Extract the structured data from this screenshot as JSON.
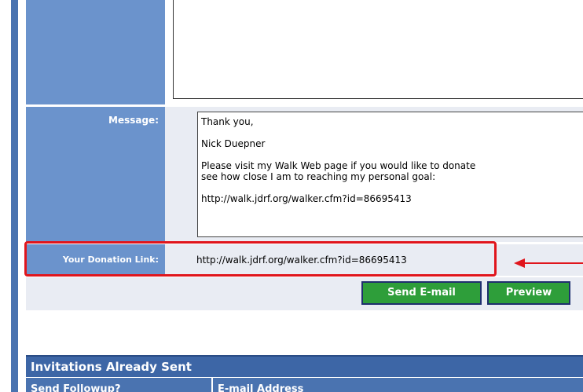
{
  "form": {
    "message_label": "Message:",
    "message_lines": [
      "Thank you,",
      "",
      "Nick Duepner",
      "",
      "Please visit my Walk Web page if you would like to donate",
      "see how close I am to reaching my personal goal:",
      "",
      "http://walk.jdrf.org/walker.cfm?id=86695413"
    ],
    "donation_label": "Your Donation Link:",
    "donation_link": "http://walk.jdrf.org/walker.cfm?id=86695413"
  },
  "buttons": {
    "send_label": "Send E-mail",
    "preview_label": "Preview"
  },
  "invitations": {
    "title": "Invitations Already Sent",
    "columns": [
      "Send Followup?",
      "E-mail Address"
    ]
  },
  "colors": {
    "label_bg": "#6b93cc",
    "header_bg": "#3d66a6",
    "button_green": "#2e9e3a",
    "highlight_red": "#e0151c"
  }
}
